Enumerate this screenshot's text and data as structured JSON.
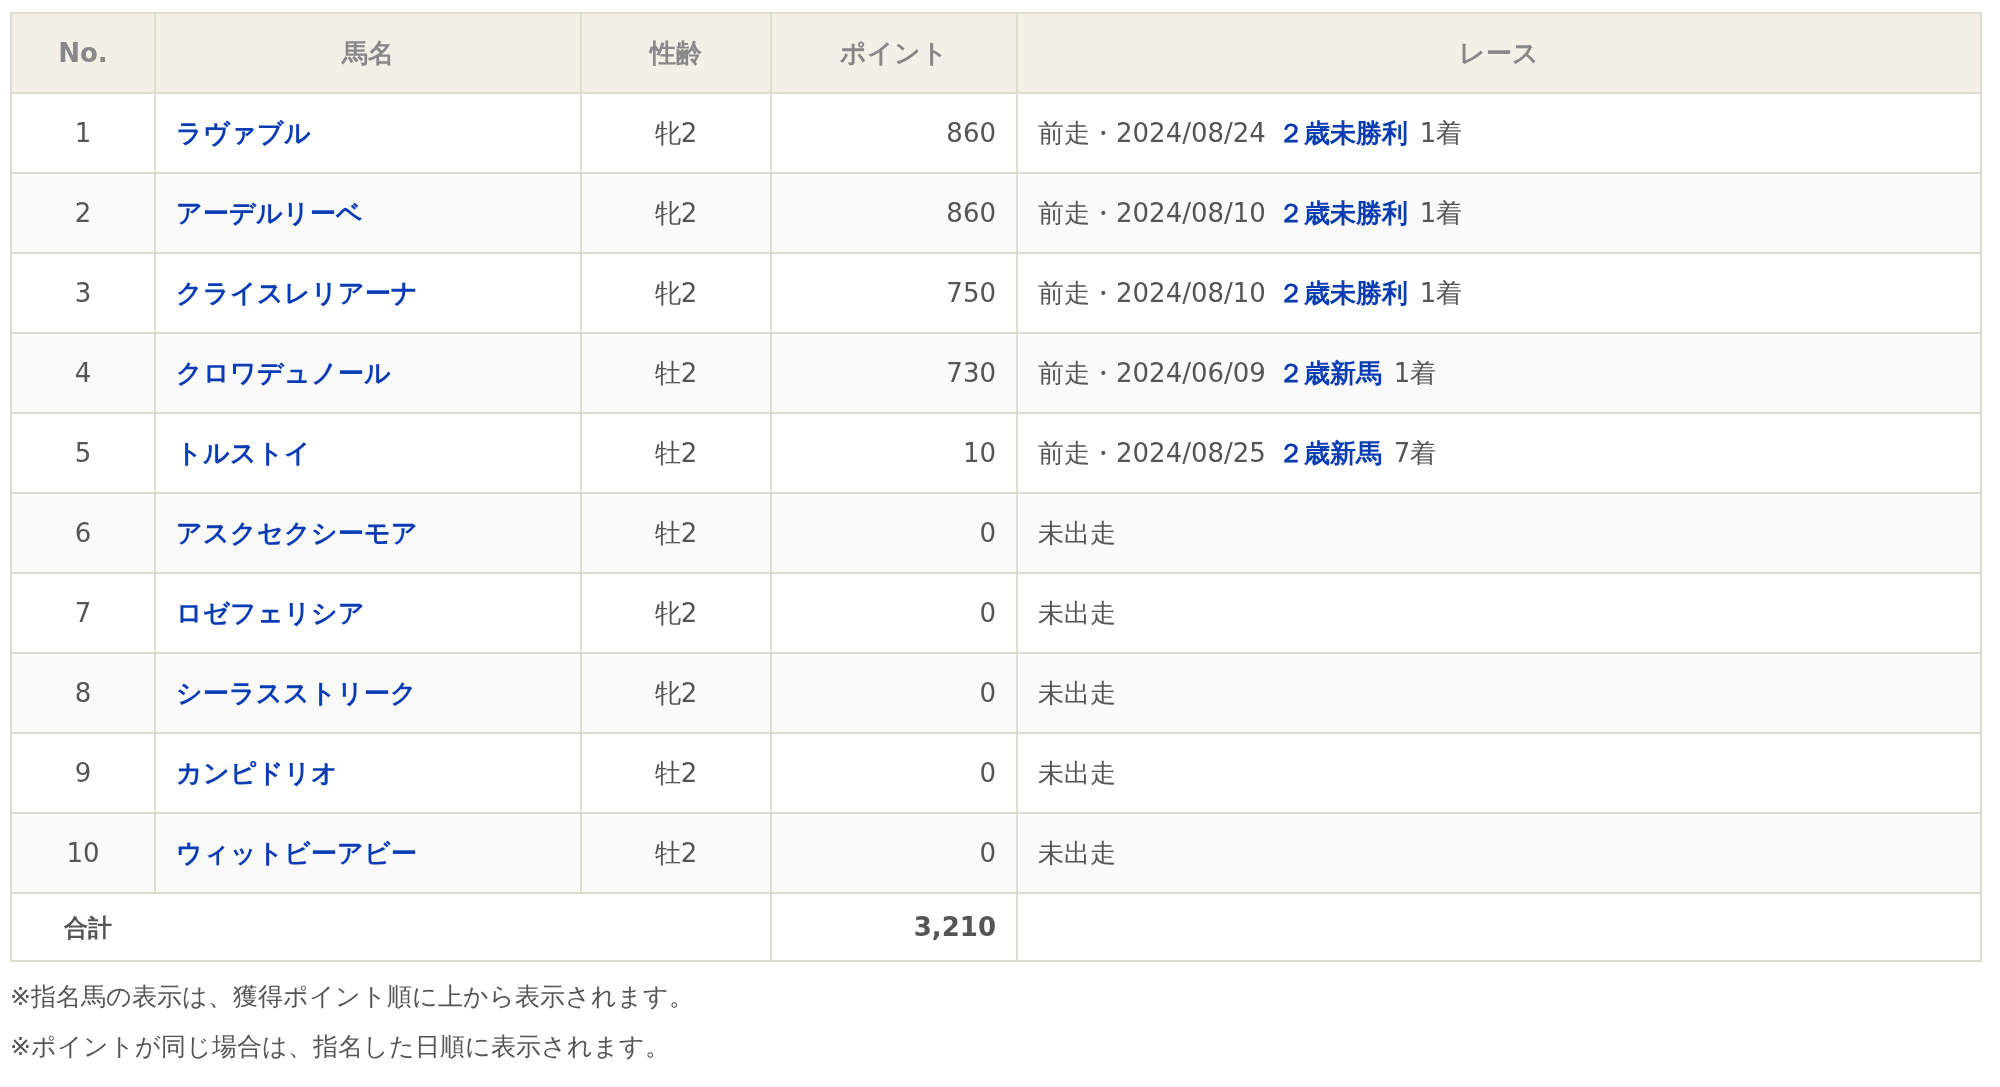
{
  "table": {
    "columns": [
      "No.",
      "馬名",
      "性齢",
      "ポイント",
      "レース"
    ],
    "rows": [
      {
        "no": "1",
        "name": "ラヴァブル",
        "sex_age": "牝2",
        "points": "860",
        "race": {
          "kind": "ran",
          "prefix": "前走・2024/08/24",
          "name": "２歳未勝利",
          "result": "1着"
        }
      },
      {
        "no": "2",
        "name": "アーデルリーベ",
        "sex_age": "牝2",
        "points": "860",
        "race": {
          "kind": "ran",
          "prefix": "前走・2024/08/10",
          "name": "２歳未勝利",
          "result": "1着"
        }
      },
      {
        "no": "3",
        "name": "クライスレリアーナ",
        "sex_age": "牝2",
        "points": "750",
        "race": {
          "kind": "ran",
          "prefix": "前走・2024/08/10",
          "name": "２歳未勝利",
          "result": "1着"
        }
      },
      {
        "no": "4",
        "name": "クロワデュノール",
        "sex_age": "牡2",
        "points": "730",
        "race": {
          "kind": "ran",
          "prefix": "前走・2024/06/09",
          "name": "２歳新馬",
          "result": "1着"
        }
      },
      {
        "no": "5",
        "name": "トルストイ",
        "sex_age": "牡2",
        "points": "10",
        "race": {
          "kind": "ran",
          "prefix": "前走・2024/08/25",
          "name": "２歳新馬",
          "result": "7着"
        }
      },
      {
        "no": "6",
        "name": "アスクセクシーモア",
        "sex_age": "牡2",
        "points": "0",
        "race": {
          "kind": "none",
          "text": "未出走"
        }
      },
      {
        "no": "7",
        "name": "ロゼフェリシア",
        "sex_age": "牝2",
        "points": "0",
        "race": {
          "kind": "none",
          "text": "未出走"
        }
      },
      {
        "no": "8",
        "name": "シーラスストリーク",
        "sex_age": "牝2",
        "points": "0",
        "race": {
          "kind": "none",
          "text": "未出走"
        }
      },
      {
        "no": "9",
        "name": "カンピドリオ",
        "sex_age": "牡2",
        "points": "0",
        "race": {
          "kind": "none",
          "text": "未出走"
        }
      },
      {
        "no": "10",
        "name": "ウィットビーアビー",
        "sex_age": "牡2",
        "points": "0",
        "race": {
          "kind": "none",
          "text": "未出走"
        }
      }
    ],
    "total": {
      "label": "合計",
      "points": "3,210"
    }
  },
  "notes": [
    "※指名馬の表示は、獲得ポイント順に上から表示されます。",
    "※ポイントが同じ場合は、指名した日順に表示されます。"
  ]
}
